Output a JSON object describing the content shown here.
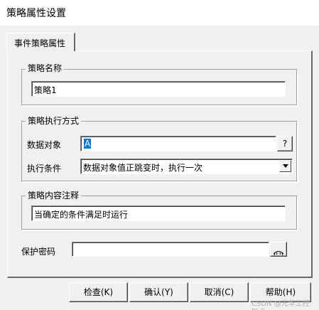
{
  "window": {
    "title": "策略属性设置"
  },
  "tab": {
    "label": "事件策略属性"
  },
  "name_group": {
    "legend": "策略名称",
    "value": "策略1"
  },
  "exec_group": {
    "legend": "策略执行方式",
    "data_object_label": "数据对象",
    "data_object_value": "A",
    "browse_label": "?",
    "condition_label": "执行条件",
    "condition_value": "数据对象值正跳变时，执行一次"
  },
  "comment_group": {
    "legend": "策略内容注释",
    "value": "当确定的条件满足时运行"
  },
  "password": {
    "label": "保护密码",
    "value": ""
  },
  "buttons": {
    "check": "检查(K)",
    "ok": "确认(Y)",
    "cancel": "取消(C)",
    "help": "帮助(H)"
  },
  "watermark": "CSDN @光华工控PLC"
}
